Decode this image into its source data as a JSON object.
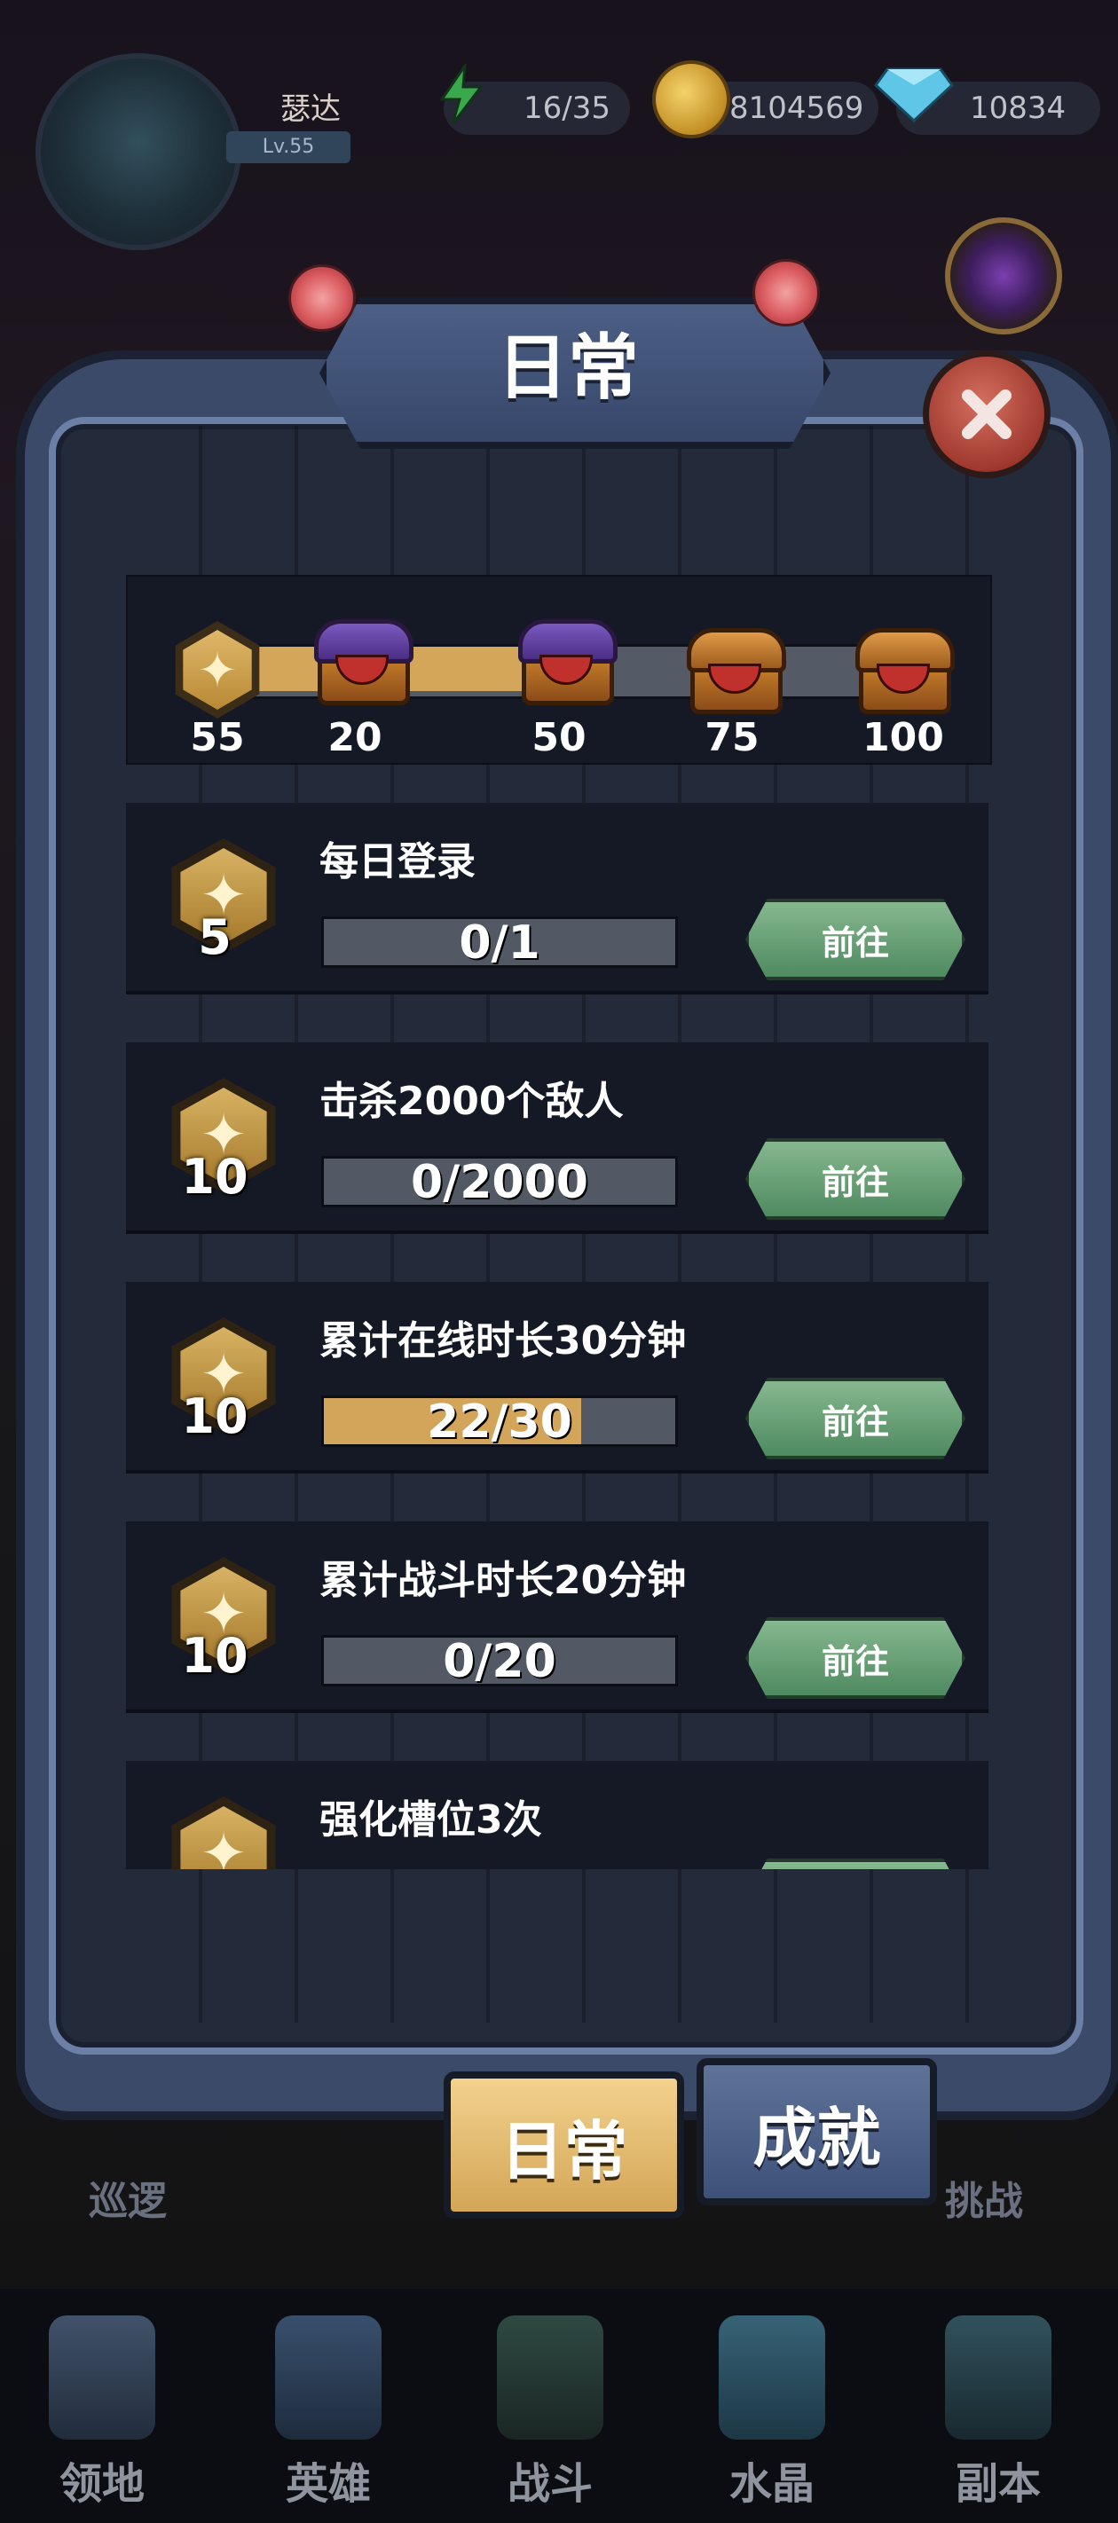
{
  "player": {
    "name": "瑟达",
    "level": "Lv.55"
  },
  "resources": {
    "energy": "16/35",
    "coins": "8104569",
    "gems": "10834"
  },
  "dialog": {
    "title": "日常"
  },
  "activity": {
    "current": "55",
    "milestones": [
      "20",
      "50",
      "75",
      "100"
    ],
    "progress_fraction": 0.47
  },
  "tasks": [
    {
      "title": "每日登录",
      "reward": "5",
      "progress": "0/1",
      "fraction": 0,
      "button": "前往"
    },
    {
      "title": "击杀2000个敌人",
      "reward": "10",
      "progress": "0/2000",
      "fraction": 0,
      "button": "前往"
    },
    {
      "title": "累计在线时长30分钟",
      "reward": "10",
      "progress": "22/30",
      "fraction": 0.733,
      "button": "前往"
    },
    {
      "title": "累计战斗时长20分钟",
      "reward": "10",
      "progress": "0/20",
      "fraction": 0,
      "button": "前往"
    },
    {
      "title": "强化槽位3次",
      "reward": "",
      "progress": "",
      "fraction": 0,
      "button": ""
    }
  ],
  "tabs": {
    "daily": "日常",
    "achievement": "成就"
  },
  "side_labels": {
    "left": "巡逻",
    "right": "挑战"
  },
  "nav": [
    "领地",
    "英雄",
    "战斗",
    "水晶",
    "副本"
  ],
  "colors": {
    "accent_gold": "#d3a65a",
    "button_green": "#5f9a6e",
    "frame_blue": "#3a4a68"
  }
}
